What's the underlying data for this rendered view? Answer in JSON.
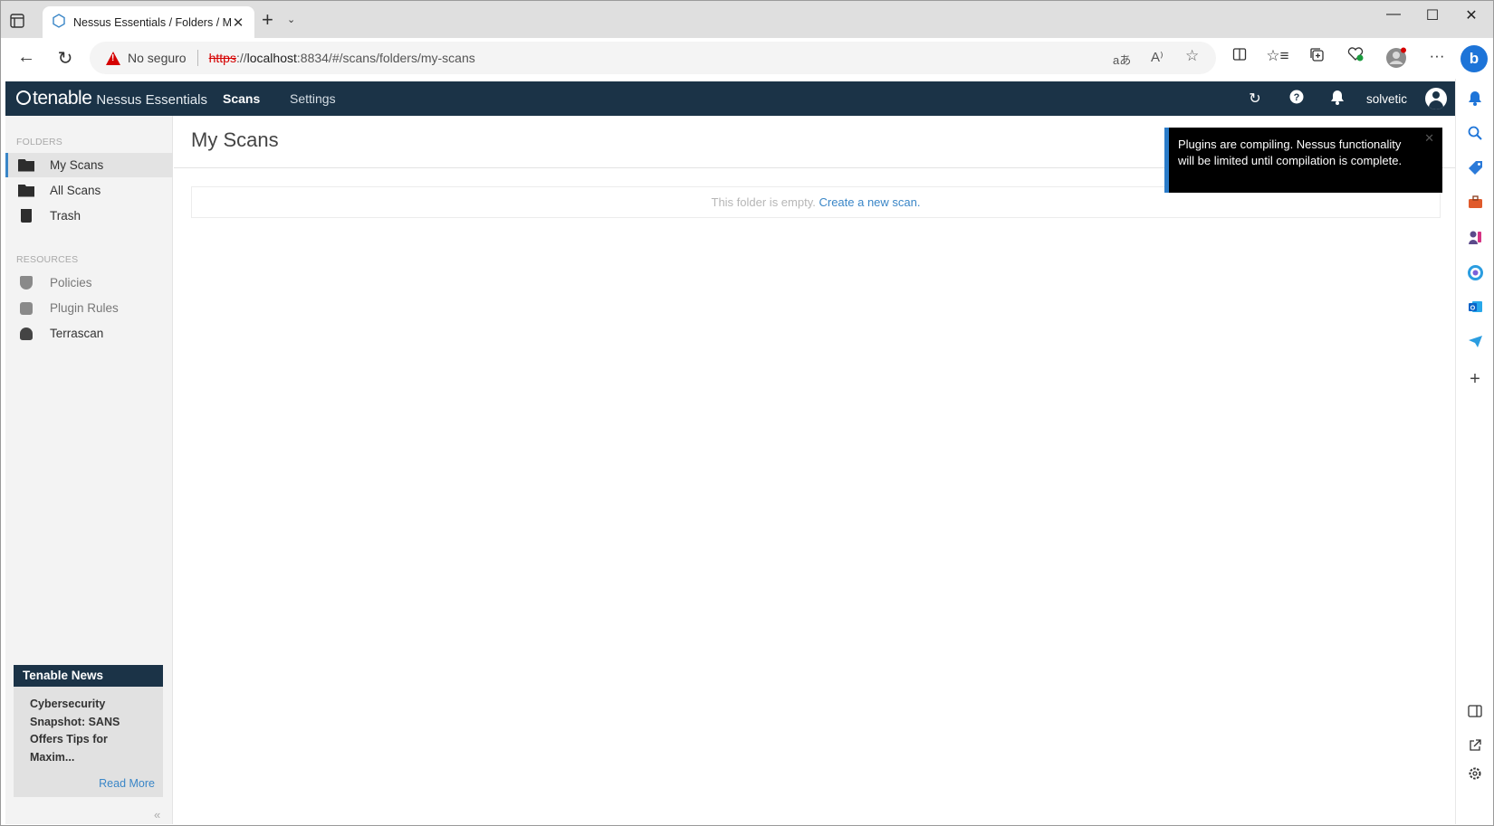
{
  "browser": {
    "tab_title": "Nessus Essentials / Folders / My",
    "new_tab": "+",
    "tab_list": "⌄",
    "close_tab": "✕",
    "window_controls": {
      "minimize": "—",
      "maximize": "☐",
      "close": "✕"
    },
    "back": "←",
    "refresh": "↻",
    "security_label": "No seguro",
    "url_scheme": "https",
    "url_separator": "://",
    "url_host": "localhost",
    "url_path": ":8834/#/scans/folders/my-scans",
    "toolbar_icons": [
      "translate-icon",
      "read-aloud-icon",
      "favorite-star-icon",
      "split-screen-icon",
      "favorites-icon",
      "collections-icon",
      "browser-essentials-icon",
      "profile-icon",
      "more-menu-icon"
    ],
    "more": "···",
    "bing": "b"
  },
  "app": {
    "logo_brand": "tenable",
    "logo_product": "Nessus Essentials",
    "nav": [
      {
        "label": "Scans",
        "active": true
      },
      {
        "label": "Settings",
        "active": false
      }
    ],
    "username": "solvetic",
    "header_icons": [
      "refresh-icon",
      "help-icon",
      "notifications-bell-icon",
      "user-avatar-icon"
    ],
    "colors": {
      "header_bg": "#1b3347",
      "accent": "#3a86c7",
      "warning": "#d50000"
    }
  },
  "sidebar": {
    "folders_heading": "FOLDERS",
    "folders": [
      {
        "label": "My Scans",
        "icon": "folder-open-icon",
        "active": true
      },
      {
        "label": "All Scans",
        "icon": "folder-icon",
        "active": false
      },
      {
        "label": "Trash",
        "icon": "trash-icon",
        "active": false
      }
    ],
    "resources_heading": "RESOURCES",
    "resources": [
      {
        "label": "Policies",
        "icon": "shield-icon"
      },
      {
        "label": "Plugin Rules",
        "icon": "plugin-icon"
      },
      {
        "label": "Terrascan",
        "icon": "terrascan-icon"
      }
    ],
    "news": {
      "heading": "Tenable News",
      "headline": "Cybersecurity Snapshot: SANS Offers Tips for Maxim...",
      "read_more": "Read More"
    },
    "collapse": "«"
  },
  "main": {
    "title": "My Scans",
    "empty_text": "This folder is empty.",
    "empty_link": "Create a new scan."
  },
  "toast": {
    "message": "Plugins are compiling. Nessus functionality will be limited until compilation is complete.",
    "close": "✕"
  },
  "edge_sidebar": {
    "icons": [
      "bell-icon",
      "search-icon",
      "shopping-tag-icon",
      "toolbox-icon",
      "games-icon",
      "microsoft365-icon",
      "outlook-icon",
      "send-icon",
      "add-icon",
      "sidebar-toggle-icon",
      "external-link-icon",
      "settings-icon"
    ],
    "add": "+"
  }
}
